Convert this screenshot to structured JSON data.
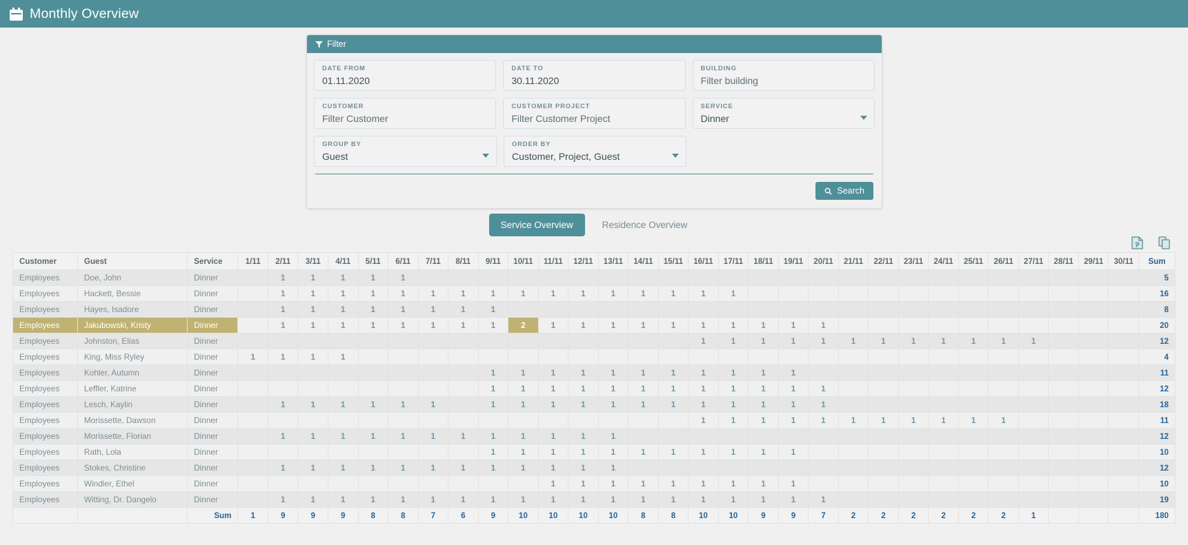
{
  "window": {
    "title": "Monthly Overview",
    "title_icon": "calendar-icon"
  },
  "filter": {
    "header": "Filter",
    "header_icon": "funnel-icon",
    "fields": [
      {
        "label": "DATE FROM",
        "value": "01.11.2020",
        "type": "date",
        "is_placeholder": false
      },
      {
        "label": "DATE TO",
        "value": "30.11.2020",
        "type": "date",
        "is_placeholder": false
      },
      {
        "label": "BUILDING",
        "value": "Filter building",
        "type": "text",
        "is_placeholder": true
      },
      {
        "label": "CUSTOMER",
        "value": "Filter Customer",
        "type": "text",
        "is_placeholder": true
      },
      {
        "label": "CUSTOMER PROJECT",
        "value": "Filter Customer Project",
        "type": "text",
        "is_placeholder": true
      },
      {
        "label": "SERVICE",
        "value": "Dinner",
        "type": "select",
        "is_placeholder": false
      },
      {
        "label": "GROUP BY",
        "value": "Guest",
        "type": "select",
        "is_placeholder": false
      },
      {
        "label": "ORDER BY",
        "value": "Customer, Project, Guest",
        "type": "select",
        "is_placeholder": false
      }
    ],
    "search_button": {
      "label": "Search",
      "icon": "search-icon"
    }
  },
  "tabs": [
    {
      "label": "Service Overview",
      "active": true
    },
    {
      "label": "Residence Overview",
      "active": false
    }
  ],
  "exports": [
    {
      "name": "export-pdf-icon",
      "label": "PDF"
    },
    {
      "name": "copy-icon",
      "label": "Copy"
    }
  ],
  "table": {
    "accent": "#4f8f99",
    "highlight": "#c0b272",
    "headers": {
      "customer": "Customer",
      "guest": "Guest",
      "service": "Service",
      "sum": "Sum"
    },
    "days": [
      "1/11",
      "2/11",
      "3/11",
      "4/11",
      "5/11",
      "6/11",
      "7/11",
      "8/11",
      "9/11",
      "10/11",
      "11/11",
      "12/11",
      "13/11",
      "14/11",
      "15/11",
      "16/11",
      "17/11",
      "18/11",
      "19/11",
      "20/11",
      "21/11",
      "22/11",
      "23/11",
      "24/11",
      "25/11",
      "26/11",
      "27/11",
      "28/11",
      "29/11",
      "30/11"
    ],
    "rows": [
      {
        "customer": "Employees",
        "guest": "Doe, John",
        "service": "Dinner",
        "values": [
          "",
          "1",
          "1",
          "1",
          "1",
          "1",
          "",
          "",
          "",
          "",
          "",
          "",
          "",
          "",
          "",
          "",
          "",
          "",
          "",
          "",
          "",
          "",
          "",
          "",
          "",
          "",
          "",
          "",
          "",
          ""
        ],
        "sum": "5",
        "highlight": false,
        "highlight_day": null
      },
      {
        "customer": "Employees",
        "guest": "Hackett, Bessie",
        "service": "Dinner",
        "values": [
          "",
          "1",
          "1",
          "1",
          "1",
          "1",
          "1",
          "1",
          "1",
          "1",
          "1",
          "1",
          "1",
          "1",
          "1",
          "1",
          "1",
          "",
          "",
          "",
          "",
          "",
          "",
          "",
          "",
          "",
          "",
          "",
          "",
          ""
        ],
        "sum": "16",
        "highlight": false,
        "highlight_day": null
      },
      {
        "customer": "Employees",
        "guest": "Hayes, Isadore",
        "service": "Dinner",
        "values": [
          "",
          "1",
          "1",
          "1",
          "1",
          "1",
          "1",
          "1",
          "1",
          "",
          "",
          "",
          "",
          "",
          "",
          "",
          "",
          "",
          "",
          "",
          "",
          "",
          "",
          "",
          "",
          "",
          "",
          "",
          "",
          ""
        ],
        "sum": "8",
        "highlight": false,
        "highlight_day": null
      },
      {
        "customer": "Employees",
        "guest": "Jakubowski, Kristy",
        "service": "Dinner",
        "values": [
          "",
          "1",
          "1",
          "1",
          "1",
          "1",
          "1",
          "1",
          "1",
          "2",
          "1",
          "1",
          "1",
          "1",
          "1",
          "1",
          "1",
          "1",
          "1",
          "1",
          "",
          "",
          "",
          "",
          "",
          "",
          "",
          "",
          "",
          ""
        ],
        "sum": "20",
        "highlight": true,
        "highlight_day": 9
      },
      {
        "customer": "Employees",
        "guest": "Johnston, Elias",
        "service": "Dinner",
        "values": [
          "",
          "",
          "",
          "",
          "",
          "",
          "",
          "",
          "",
          "",
          "",
          "",
          "",
          "",
          "",
          "1",
          "1",
          "1",
          "1",
          "1",
          "1",
          "1",
          "1",
          "1",
          "1",
          "1",
          "1",
          "",
          "",
          ""
        ],
        "sum": "12",
        "highlight": false,
        "highlight_day": null
      },
      {
        "customer": "Employees",
        "guest": "King, Miss Ryley",
        "service": "Dinner",
        "values": [
          "1",
          "1",
          "1",
          "1",
          "",
          "",
          "",
          "",
          "",
          "",
          "",
          "",
          "",
          "",
          "",
          "",
          "",
          "",
          "",
          "",
          "",
          "",
          "",
          "",
          "",
          "",
          "",
          "",
          "",
          ""
        ],
        "sum": "4",
        "highlight": false,
        "highlight_day": null
      },
      {
        "customer": "Employees",
        "guest": "Kohler, Autumn",
        "service": "Dinner",
        "values": [
          "",
          "",
          "",
          "",
          "",
          "",
          "",
          "",
          "1",
          "1",
          "1",
          "1",
          "1",
          "1",
          "1",
          "1",
          "1",
          "1",
          "1",
          "",
          "",
          "",
          "",
          "",
          "",
          "",
          "",
          "",
          "",
          ""
        ],
        "sum": "11",
        "highlight": false,
        "highlight_day": null
      },
      {
        "customer": "Employees",
        "guest": "Leffler, Katrine",
        "service": "Dinner",
        "values": [
          "",
          "",
          "",
          "",
          "",
          "",
          "",
          "",
          "1",
          "1",
          "1",
          "1",
          "1",
          "1",
          "1",
          "1",
          "1",
          "1",
          "1",
          "1",
          "",
          "",
          "",
          "",
          "",
          "",
          "",
          "",
          "",
          ""
        ],
        "sum": "12",
        "highlight": false,
        "highlight_day": null
      },
      {
        "customer": "Employees",
        "guest": "Lesch, Kaylin",
        "service": "Dinner",
        "values": [
          "",
          "1",
          "1",
          "1",
          "1",
          "1",
          "1",
          "",
          "1",
          "1",
          "1",
          "1",
          "1",
          "1",
          "1",
          "1",
          "1",
          "1",
          "1",
          "1",
          "",
          "",
          "",
          "",
          "",
          "",
          "",
          "",
          "",
          ""
        ],
        "sum": "18",
        "highlight": false,
        "highlight_day": null
      },
      {
        "customer": "Employees",
        "guest": "Morissette, Dawson",
        "service": "Dinner",
        "values": [
          "",
          "",
          "",
          "",
          "",
          "",
          "",
          "",
          "",
          "",
          "",
          "",
          "",
          "",
          "",
          "1",
          "1",
          "1",
          "1",
          "1",
          "1",
          "1",
          "1",
          "1",
          "1",
          "1",
          "",
          "",
          "",
          ""
        ],
        "sum": "11",
        "highlight": false,
        "highlight_day": null
      },
      {
        "customer": "Employees",
        "guest": "Morissette, Florian",
        "service": "Dinner",
        "values": [
          "",
          "1",
          "1",
          "1",
          "1",
          "1",
          "1",
          "1",
          "1",
          "1",
          "1",
          "1",
          "1",
          "",
          "",
          "",
          "",
          "",
          "",
          "",
          "",
          "",
          "",
          "",
          "",
          "",
          "",
          "",
          "",
          ""
        ],
        "sum": "12",
        "highlight": false,
        "highlight_day": null
      },
      {
        "customer": "Employees",
        "guest": "Rath, Lola",
        "service": "Dinner",
        "values": [
          "",
          "",
          "",
          "",
          "",
          "",
          "",
          "",
          "1",
          "1",
          "1",
          "1",
          "1",
          "1",
          "1",
          "1",
          "1",
          "1",
          "1",
          "",
          "",
          "",
          "",
          "",
          "",
          "",
          "",
          "",
          "",
          ""
        ],
        "sum": "10",
        "highlight": false,
        "highlight_day": null
      },
      {
        "customer": "Employees",
        "guest": "Stokes, Christine",
        "service": "Dinner",
        "values": [
          "",
          "1",
          "1",
          "1",
          "1",
          "1",
          "1",
          "1",
          "1",
          "1",
          "1",
          "1",
          "1",
          "",
          "",
          "",
          "",
          "",
          "",
          "",
          "",
          "",
          "",
          "",
          "",
          "",
          "",
          "",
          "",
          ""
        ],
        "sum": "12",
        "highlight": false,
        "highlight_day": null
      },
      {
        "customer": "Employees",
        "guest": "Windler, Ethel",
        "service": "Dinner",
        "values": [
          "",
          "",
          "",
          "",
          "",
          "",
          "",
          "",
          "",
          "",
          "1",
          "1",
          "1",
          "1",
          "1",
          "1",
          "1",
          "1",
          "1",
          "",
          "",
          "",
          "",
          "",
          "",
          "",
          "",
          "",
          "",
          ""
        ],
        "sum": "10",
        "highlight": false,
        "highlight_day": null
      },
      {
        "customer": "Employees",
        "guest": "Witting, Dr. Dangelo",
        "service": "Dinner",
        "values": [
          "",
          "1",
          "1",
          "1",
          "1",
          "1",
          "1",
          "1",
          "1",
          "1",
          "1",
          "1",
          "1",
          "1",
          "1",
          "1",
          "1",
          "1",
          "1",
          "1",
          "",
          "",
          "",
          "",
          "",
          "",
          "",
          "",
          "",
          ""
        ],
        "sum": "19",
        "highlight": false,
        "highlight_day": null
      }
    ],
    "footer": {
      "label": "Sum",
      "values": [
        "1",
        "9",
        "9",
        "9",
        "8",
        "8",
        "7",
        "6",
        "9",
        "10",
        "10",
        "10",
        "10",
        "8",
        "8",
        "10",
        "10",
        "9",
        "9",
        "7",
        "2",
        "2",
        "2",
        "2",
        "2",
        "2",
        "1",
        "",
        "",
        ""
      ],
      "total": "180"
    }
  }
}
